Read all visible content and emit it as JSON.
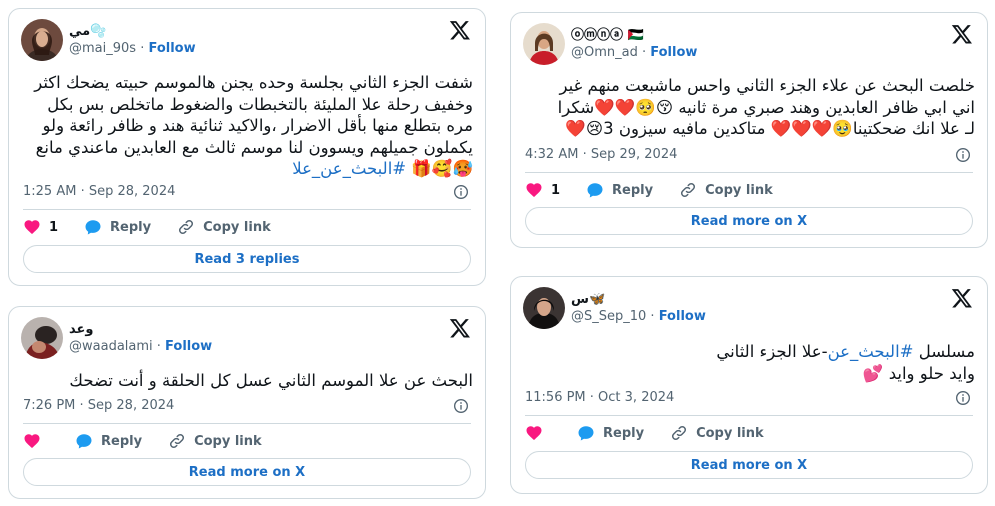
{
  "brand_color": "#1d6fc5",
  "like_color": "#f91880",
  "tweets": [
    {
      "display_name": "مي",
      "name_emoji": "🫧",
      "handle": "@mai_90s",
      "follow": "Follow",
      "text": "شفت الجزء الثاني بجلسة وحده يجنن هالموسم حبيته يضحك اكثر وخفيف رحلة علا المليئة بالتخبطات والضغوط ماتخلص بس بكل مره بتطلع منها بأقل الاضرار ،والاكيد ثنائية هند و ظافر رائعة ولو يكملون جميلهم ويسوون لنا موسم ثالث مع العابدين ماعندي مانع🥵🥰🎁",
      "hashtag": "#البحث_عن_علا",
      "time": "1:25 AM · Sep 28, 2024",
      "likes": "1",
      "reply": "Reply",
      "copy_link": "Copy link",
      "button": "Read 3 replies"
    },
    {
      "display_name": "وعد",
      "handle": "@waadalami",
      "follow": "Follow",
      "text": "البحث عن علا الموسم الثاني عسل كل الحلقة و أنت تضحك",
      "time": "7:26 PM · Sep 28, 2024",
      "reply": "Reply",
      "copy_link": "Copy link",
      "button": "Read more on X"
    },
    {
      "display_name": "ⓞⓜⓝⓐ",
      "name_emoji": "🇵🇸",
      "handle": "@Omn_ad",
      "follow": "Follow",
      "text_line1": "خلصت البحث عن علاء الجزء الثاني واحس ماشبعت منهم غير",
      "text_line2": "اني ابي ظافر العابدين وهند صبري مرة ثانيه 😚🥺❤️❤️شكرا",
      "text_line3": "لـ علا انك ضحكتينا🥹❤️❤️❤️ متاكدين مافيه سيزون 3😢❤️",
      "time": "4:32 AM · Sep 29, 2024",
      "likes": "1",
      "reply": "Reply",
      "copy_link": "Copy link",
      "button": "Read more on X"
    },
    {
      "display_name": "س",
      "name_emoji": "🦋",
      "handle": "@S_Sep_10",
      "follow": "Follow",
      "text_prefix": "مسلسل",
      "hashtag": "#البحث_عن",
      "text_suffix": "-علا الجزء الثاني",
      "text_line2": "وايد حلو وايد 💕",
      "time": "11:56 PM · Oct 3, 2024",
      "reply": "Reply",
      "copy_link": "Copy link",
      "button": "Read more on X"
    }
  ]
}
